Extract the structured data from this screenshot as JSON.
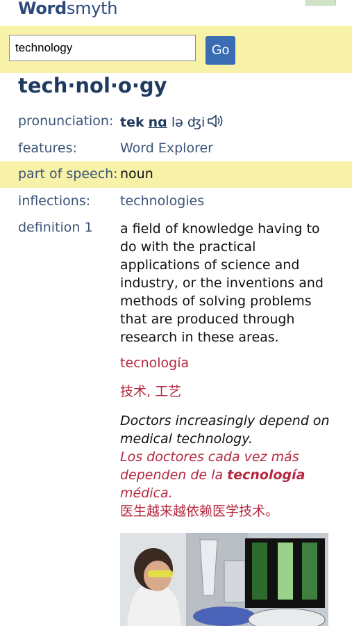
{
  "header": {
    "logo_bold": "Word",
    "logo_light": "smyth"
  },
  "search": {
    "value": "technology",
    "go_label": "Go"
  },
  "entry": {
    "headword": "tech·nol·o·gy",
    "pronunciation": {
      "label": "pronunciation:",
      "p1": "tek",
      "p2": "nɑ",
      "p3": " lə ʤi",
      "speaker_icon": "speaker-icon"
    },
    "features": {
      "label": "features:",
      "value": "Word Explorer"
    },
    "part_of_speech": {
      "label": "part of speech:",
      "value": "noun"
    },
    "inflections": {
      "label": "inflections:",
      "value": "technologies"
    },
    "definition": {
      "label": "definition 1",
      "text": "a field of knowledge having to do with the practical applications of science and industry, or the inventions and methods of solving problems that are produced through research in these areas.",
      "spanish": "tecnología",
      "chinese": "技术, 工艺",
      "example": {
        "en": "Doctors increasingly depend on medical technology.",
        "es_before": "Los doctores cada vez más dependen de la ",
        "es_bold": "tecnología",
        "es_after": " médica.",
        "zh": "医生越来越依赖医学技术。"
      }
    }
  },
  "colors": {
    "highlight": "#f8f1a8",
    "brand": "#2b4a7c",
    "translation": "#b5283f",
    "button": "#3a6cb3"
  }
}
